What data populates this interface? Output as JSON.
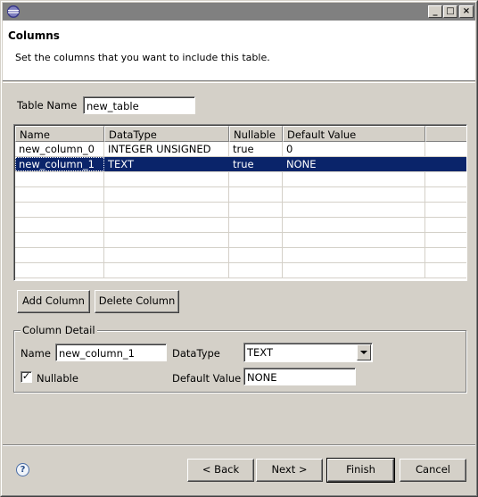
{
  "window": {
    "app_icon": "eclipse-icon",
    "controls": [
      "minimize-icon",
      "maximize-icon",
      "close-icon"
    ]
  },
  "banner": {
    "title": "Columns",
    "description": "Set the columns that you want to include this table."
  },
  "table_name": {
    "label": "Table Name",
    "value": "new_table"
  },
  "columns_table": {
    "headers": [
      "Name",
      "DataType",
      "Nullable",
      "Default Value"
    ],
    "rows": [
      {
        "name": "new_column_0",
        "datatype": "INTEGER UNSIGNED",
        "nullable": "true",
        "default": "0"
      },
      {
        "name": "new_column_1",
        "datatype": "TEXT",
        "nullable": "true",
        "default": "NONE"
      }
    ],
    "selected_row": 1
  },
  "buttons": {
    "add_column": "Add Column",
    "delete_column": "Delete Column"
  },
  "column_detail": {
    "legend": "Column Detail",
    "name_label": "Name",
    "name_value": "new_column_1",
    "datatype_label": "DataType",
    "datatype_value": "TEXT",
    "nullable_label": "Nullable",
    "nullable_checked": true,
    "default_label": "Default Value",
    "default_value": "NONE"
  },
  "footer": {
    "help_icon": "help-icon",
    "back": "< Back",
    "next": "Next >",
    "finish": "Finish",
    "cancel": "Cancel"
  },
  "colors": {
    "selection": "#0a246a",
    "dialog_bg": "#d4d0c8"
  }
}
